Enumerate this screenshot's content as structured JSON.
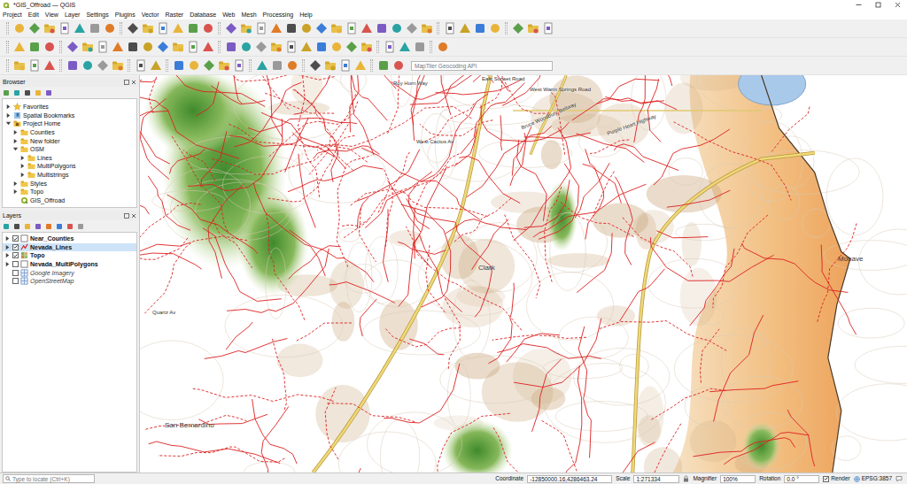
{
  "window": {
    "title": "*GIS_Offroad — QGIS"
  },
  "menu": [
    "Project",
    "Edit",
    "View",
    "Layer",
    "Settings",
    "Plugins",
    "Vector",
    "Raster",
    "Database",
    "Web",
    "Mesh",
    "Processing",
    "Help"
  ],
  "locator_toolbar": {
    "placeholder": "MapTiler Geocoding API"
  },
  "browser": {
    "title": "Browser",
    "items": [
      {
        "label": "Favorites",
        "kind": "favorites",
        "expandable": true,
        "expanded": false,
        "children": []
      },
      {
        "label": "Spatial Bookmarks",
        "kind": "bookmarks",
        "expandable": true,
        "expanded": false,
        "children": []
      },
      {
        "label": "Project Home",
        "kind": "home",
        "expandable": true,
        "expanded": true,
        "children": [
          {
            "label": "Counties",
            "kind": "folder",
            "expandable": true,
            "expanded": false,
            "children": []
          },
          {
            "label": "New folder",
            "kind": "folder",
            "expandable": true,
            "expanded": false,
            "children": []
          },
          {
            "label": "OSM",
            "kind": "folder",
            "expandable": true,
            "expanded": true,
            "children": [
              {
                "label": "Lines",
                "kind": "folder",
                "expandable": true,
                "expanded": false,
                "children": []
              },
              {
                "label": "MultiPolygons",
                "kind": "folder",
                "expandable": true,
                "expanded": false,
                "children": []
              },
              {
                "label": "Multistrings",
                "kind": "folder",
                "expandable": true,
                "expanded": false,
                "children": []
              }
            ]
          },
          {
            "label": "Styles",
            "kind": "folder",
            "expandable": true,
            "expanded": false,
            "children": []
          },
          {
            "label": "Topo",
            "kind": "folder",
            "expandable": true,
            "expanded": false,
            "children": []
          },
          {
            "label": "GIS_Offroad",
            "kind": "project",
            "expandable": false,
            "expanded": false,
            "children": []
          }
        ]
      }
    ]
  },
  "layers": {
    "title": "Layers",
    "items": [
      {
        "label": "Near_Counties",
        "kind": "polygon",
        "checked": true,
        "selected": false,
        "expandable": true,
        "expanded": false
      },
      {
        "label": "Nevada_Lines",
        "kind": "line",
        "checked": true,
        "selected": true,
        "expandable": true,
        "expanded": false
      },
      {
        "label": "Topo",
        "kind": "raster",
        "checked": true,
        "selected": false,
        "expandable": true,
        "expanded": false
      },
      {
        "label": "Nevada_MultiPolygons",
        "kind": "polygon",
        "checked": false,
        "selected": false,
        "expandable": true,
        "expanded": false
      },
      {
        "label": "Google Imagery",
        "kind": "xyz",
        "checked": false,
        "selected": false,
        "expandable": false,
        "expanded": false
      },
      {
        "label": "OpenStreetMap",
        "kind": "xyz",
        "checked": false,
        "selected": false,
        "expandable": false,
        "expanded": false
      }
    ]
  },
  "map": {
    "labels": [
      {
        "text": "Clark",
        "kind": "county"
      },
      {
        "text": "Mohave",
        "kind": "county"
      },
      {
        "text": "San Bernardino",
        "kind": "county"
      },
      {
        "text": "Roy Horn Way",
        "kind": "road"
      },
      {
        "text": "East Sunset Road",
        "kind": "road"
      },
      {
        "text": "West Warm Springs Road",
        "kind": "road"
      },
      {
        "text": "West Cactus Av",
        "kind": "road"
      },
      {
        "text": "Quartz Av",
        "kind": "road"
      },
      {
        "text": "Bruce Woodbury Beltway",
        "kind": "road"
      },
      {
        "text": "Purple Heart Highway",
        "kind": "road"
      }
    ]
  },
  "status_bar": {
    "search_placeholder": "Type to locate (Ctrl+K)",
    "coordinate_label": "Coordinate",
    "coordinate": "-12850000.16,4286463.24",
    "scale_label": "Scale",
    "scale": "1:271334",
    "magnifier_label": "Magnifier",
    "magnifier": "100%",
    "rotation_label": "Rotation",
    "rotation": "0.0 °",
    "render_label": "Render",
    "render_checked": true,
    "crs": "EPSG:3857"
  }
}
